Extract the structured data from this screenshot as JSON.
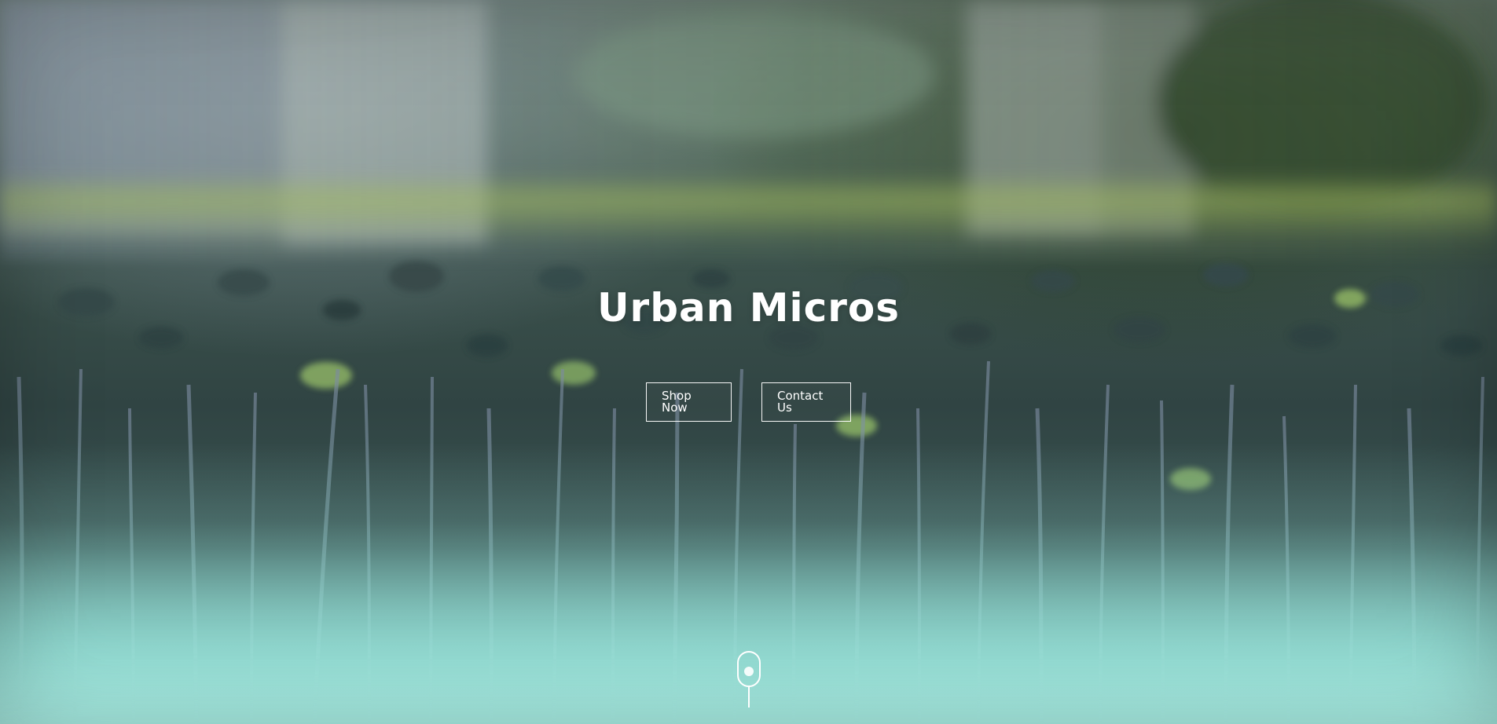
{
  "hero": {
    "title": "Urban Micros",
    "buttons": [
      {
        "label": "Shop Now"
      },
      {
        "label": "Contact Us"
      }
    ]
  },
  "colors": {
    "accent_text": "#ffffff",
    "mint_glow": "#a4e8e0",
    "forest_dark": "#304443"
  },
  "icons": {
    "scroll": "mouse-scroll-icon"
  }
}
